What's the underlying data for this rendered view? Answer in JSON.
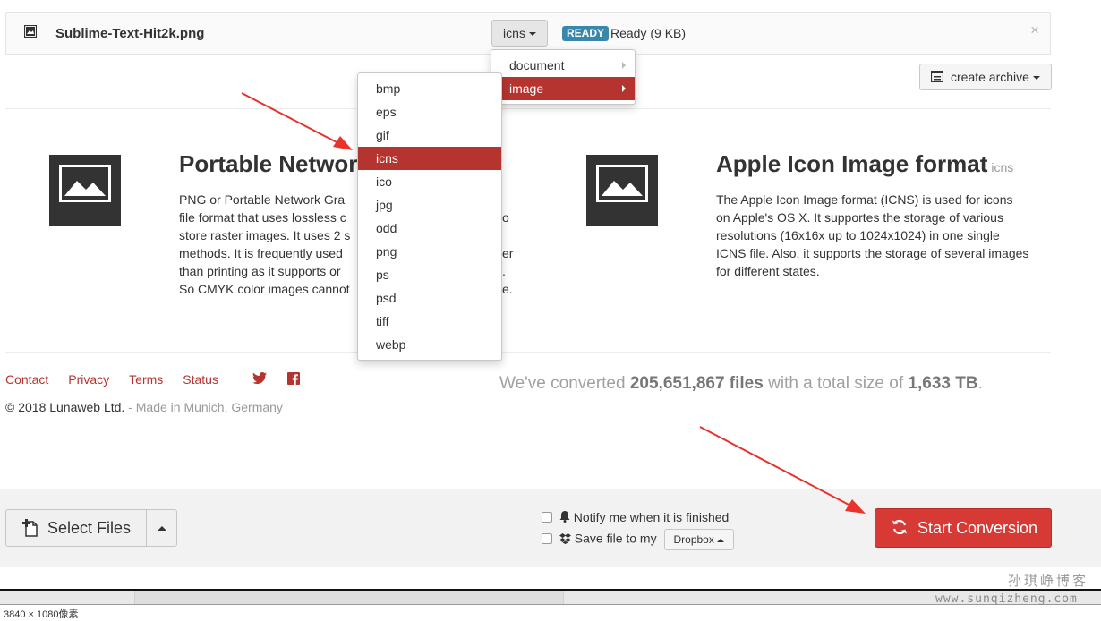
{
  "file_row": {
    "file_name": "Sublime-Text-Hit2k.png",
    "format_selected": "icns",
    "status_badge": "READY",
    "status_text": "Ready (9 KB)",
    "close_glyph": "×"
  },
  "archive_button": {
    "label": "create archive"
  },
  "category_menu": {
    "items": [
      {
        "label": "document",
        "active": false
      },
      {
        "label": "image",
        "active": true
      }
    ]
  },
  "format_menu": {
    "items": [
      "bmp",
      "eps",
      "gif",
      "icns",
      "ico",
      "jpg",
      "odd",
      "png",
      "ps",
      "psd",
      "tiff",
      "webp"
    ],
    "active": "icns"
  },
  "source_format": {
    "title": "Portable Networ",
    "desc_lines": [
      "PNG or Portable Network Gra",
      "file format that uses lossless c",
      "store raster images. It uses 2 s",
      "methods. It is frequently used",
      "than printing as it supports or",
      "So CMYK color images cannot"
    ],
    "desc_right_fragments": [
      "o",
      "er",
      ".",
      "e."
    ]
  },
  "target_format": {
    "title": "Apple Icon Image format",
    "ext": "icns",
    "desc_lines": [
      "The Apple Icon Image format (ICNS) is used for icons",
      "on Apple's OS X. It supportes the storage of various",
      "resolutions (16x16x up to 1024x1024) in one single",
      "ICNS file. Also, it supports the storage of several images",
      "for different states."
    ]
  },
  "footer": {
    "links": [
      "Contact",
      "Privacy",
      "Terms",
      "Status"
    ],
    "copyright": "© 2018 Lunaweb Ltd.",
    "made_in": " - Made in Munich, Germany",
    "stats": {
      "prefix": "We've converted ",
      "files": "205,651,867 files",
      "middle": " with a total size of ",
      "size": "1,633 TB",
      "suffix": "."
    }
  },
  "bottom_bar": {
    "select_files": "Select Files",
    "notify_label": "Notify me when it is finished",
    "save_label": "Save file to my",
    "dropbox_label": "Dropbox",
    "start_button": "Start Conversion"
  },
  "tool_strip": {
    "status_text": "3840 × 1080像素"
  },
  "watermark": {
    "line1": "孙琪峥博客",
    "line2": "www.sunqizheng.com"
  },
  "colors": {
    "accent_red": "#b5342f",
    "start_button": "#d73a34",
    "ready_badge": "#3a87ad",
    "annotation_arrow": "#e8322b"
  }
}
